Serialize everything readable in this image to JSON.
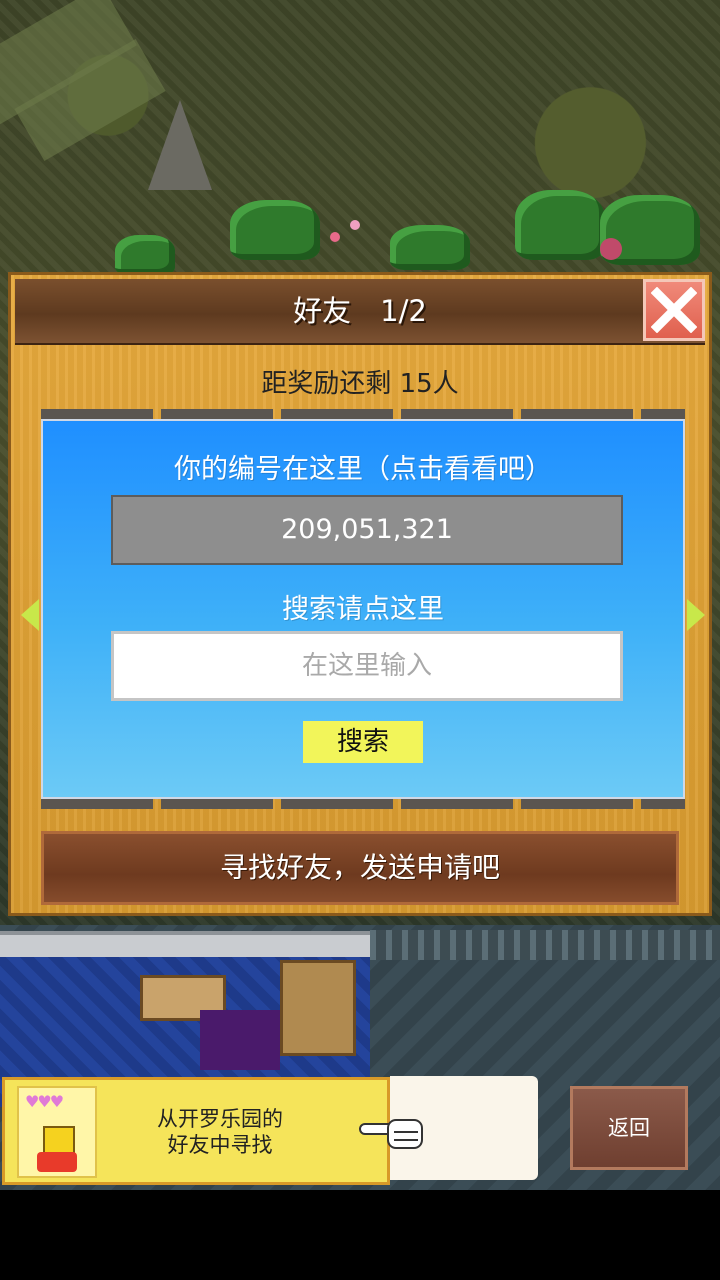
{
  "dialog": {
    "title": "好友　1/2",
    "reward_remaining": "距奖励还剩 15人",
    "id_prompt": "你的编号在这里（点击看看吧）",
    "player_id": "209,051,321",
    "search_prompt": "搜索请点这里",
    "search_placeholder": "在这里输入",
    "search_button": "搜索",
    "find_friends_button": "寻找好友，发送申请吧",
    "close_icon": "close-x-icon",
    "prev_icon": "arrow-left-icon",
    "next_icon": "arrow-right-icon"
  },
  "bottom_bar": {
    "kairo_friends_label_line1": "从开罗乐园的",
    "kairo_friends_label_line2": "好友中寻找",
    "back_button": "返回"
  },
  "colors": {
    "dialog_wood": "#e0a235",
    "header_brown": "#6a4226",
    "panel_blue": "#2f9ff8",
    "close_red": "#e8705e",
    "search_yellow": "#f2f55a"
  }
}
